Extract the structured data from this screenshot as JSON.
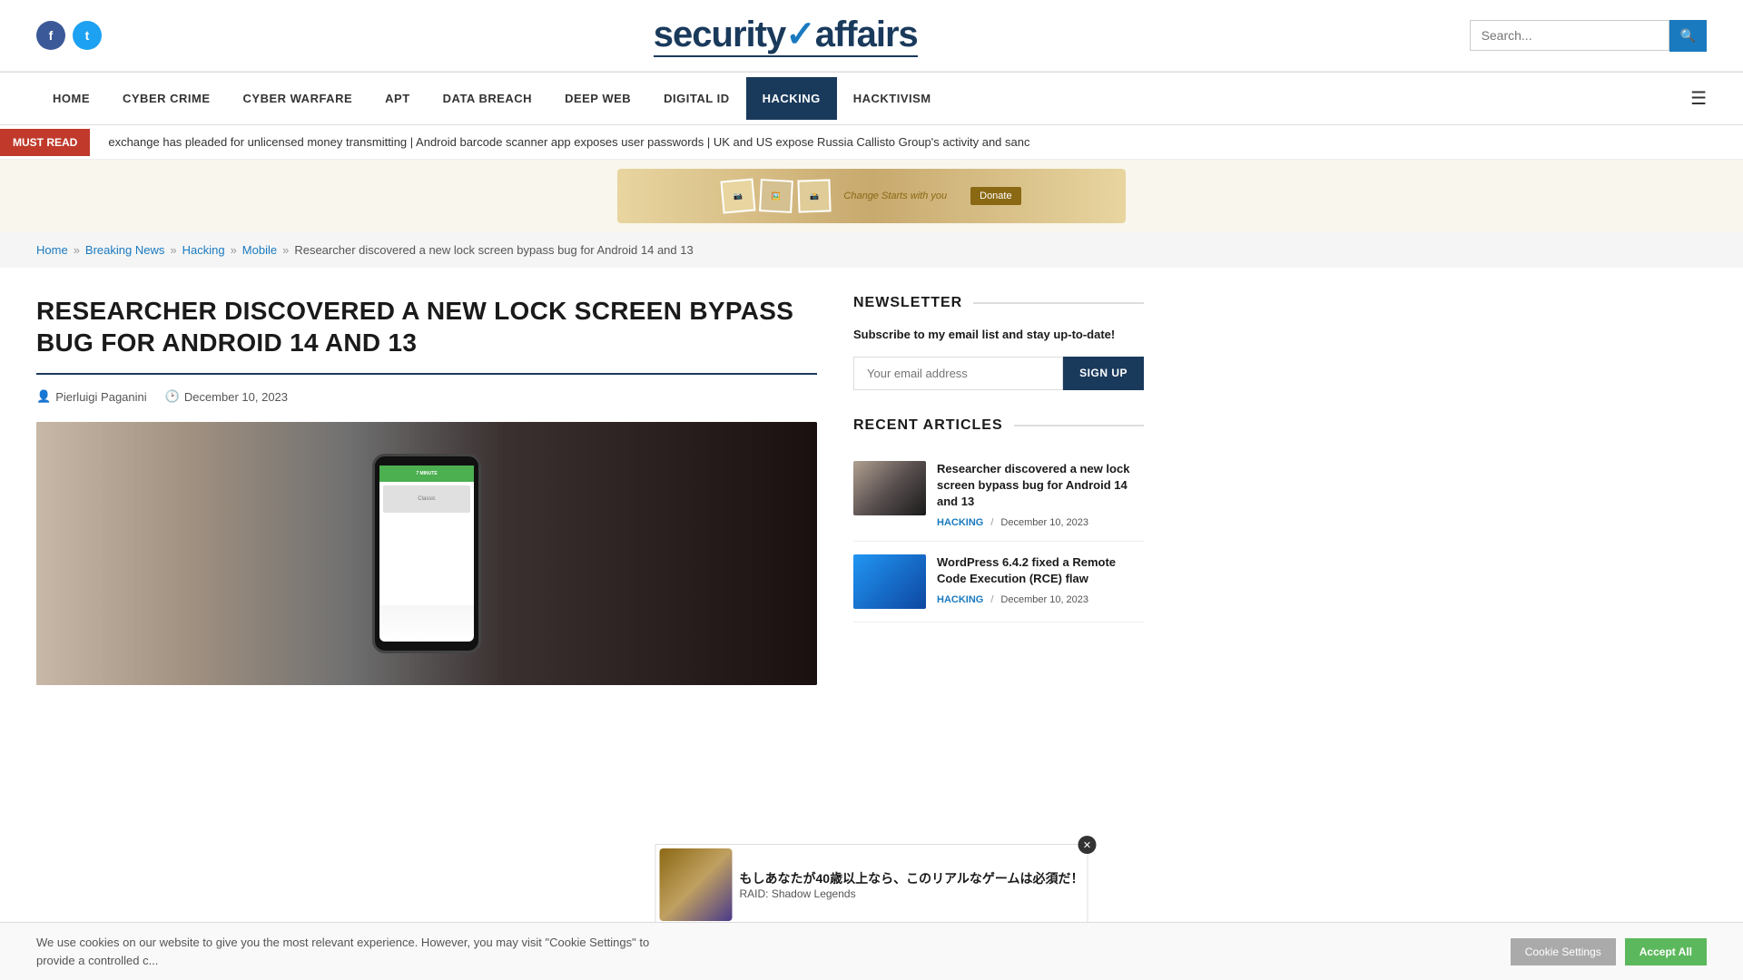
{
  "site": {
    "name": "securityaffairs",
    "logo_part1": "security",
    "logo_part2": "affairs"
  },
  "header": {
    "search_placeholder": "Search...",
    "search_button_label": "🔍"
  },
  "social": {
    "facebook_label": "f",
    "twitter_label": "t"
  },
  "nav": {
    "items": [
      {
        "label": "HOME",
        "active": false
      },
      {
        "label": "CYBER CRIME",
        "active": false
      },
      {
        "label": "CYBER WARFARE",
        "active": false
      },
      {
        "label": "APT",
        "active": false
      },
      {
        "label": "DATA BREACH",
        "active": false
      },
      {
        "label": "DEEP WEB",
        "active": false
      },
      {
        "label": "DIGITAL ID",
        "active": false
      },
      {
        "label": "HACKING",
        "active": true
      },
      {
        "label": "HACKTIVISM",
        "active": false
      }
    ]
  },
  "ticker": {
    "must_read_label": "MUST READ",
    "content": "exchange has pleaded for unlicensed money transmitting  |  Android barcode scanner app exposes user passwords  |  UK and US expose Russia Callisto Group's activity and sanc"
  },
  "breadcrumb": {
    "items": [
      {
        "label": "Home",
        "link": true
      },
      {
        "label": "Breaking News",
        "link": true
      },
      {
        "label": "Hacking",
        "link": true
      },
      {
        "label": "Mobile",
        "link": true
      },
      {
        "label": "Researcher discovered a new lock screen bypass bug for Android 14 and 13",
        "link": false
      }
    ]
  },
  "article": {
    "title": "RESEARCHER DISCOVERED A NEW LOCK SCREEN BYPASS BUG FOR ANDROID 14 AND 13",
    "author": "Pierluigi Paganini",
    "date": "December 10, 2023"
  },
  "newsletter": {
    "section_title": "NEWSLETTER",
    "description": "Subscribe to my email list and stay up-to-date!",
    "email_placeholder": "Your email address",
    "signup_label": "SIGN UP"
  },
  "recent_articles": {
    "section_title": "RECENT ARTICLES",
    "items": [
      {
        "title": "Researcher discovered a new lock screen bypass bug for Android 14 and 13",
        "tag": "HACKING",
        "date": "December 10, 2023",
        "thumb_type": "phone"
      },
      {
        "title": "WordPress 6.4.2 fixed a Remote Code Execution (RCE) flaw",
        "tag": "HACKING",
        "date": "December 10, 2023",
        "thumb_type": "wp"
      }
    ]
  },
  "cookie": {
    "text": "We use cookies on our website to give you the most relevant experience. However, you may visit \"Cookie Settings\" to provide a controlled c...",
    "settings_label": "Cookie Settings",
    "accept_label": "Accept All"
  },
  "ad_game": {
    "text": "もしあなたが40歳以上なら、このリアルなゲームは必須だ！",
    "subtitle": "RAID: Shadow Legends",
    "close_label": "✕"
  }
}
